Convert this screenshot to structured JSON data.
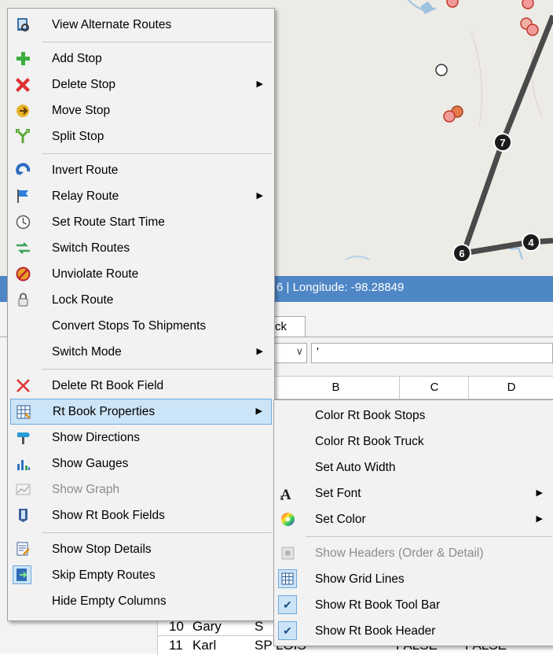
{
  "status_bar": {
    "text": "6 | Longitude: -98.28849"
  },
  "sheet_tab": {
    "label": "ck"
  },
  "formula_bar": {
    "value": "'"
  },
  "columns": [
    "B",
    "C",
    "D"
  ],
  "rows": [
    {
      "num": "10",
      "name": "Gary",
      "col_b": "S"
    },
    {
      "num": "11",
      "name": "Karl",
      "col_b": "SP LOIS",
      "col_c": "FALSE",
      "col_d": "FALSE"
    }
  ],
  "map": {
    "route_markers": [
      "7",
      "6",
      "4"
    ]
  },
  "context_menu": {
    "items": [
      {
        "label": "View Alternate Routes",
        "icon": "view-routes-icon"
      },
      {
        "label": "Add Stop",
        "icon": "green-plus-icon"
      },
      {
        "label": "Delete Stop",
        "icon": "red-x-icon",
        "submenu": true
      },
      {
        "label": "Move Stop",
        "icon": "move-stop-icon"
      },
      {
        "label": "Split Stop",
        "icon": "split-icon"
      },
      {
        "label": "Invert Route",
        "icon": "invert-icon"
      },
      {
        "label": "Relay Route",
        "icon": "flag-icon",
        "submenu": true
      },
      {
        "label": "Set Route Start Time",
        "icon": "clock-icon"
      },
      {
        "label": "Switch Routes",
        "icon": "switch-icon"
      },
      {
        "label": "Unviolate Route",
        "icon": "unviolate-icon"
      },
      {
        "label": "Lock Route",
        "icon": "lock-icon"
      },
      {
        "label": "Convert Stops To Shipments",
        "icon": ""
      },
      {
        "label": "Switch Mode",
        "icon": "",
        "submenu": true
      },
      {
        "label": "Delete Rt Book Field",
        "icon": "red-x-thin-icon"
      },
      {
        "label": "Rt Book Properties",
        "icon": "properties-icon",
        "submenu": true,
        "highlighted": true
      },
      {
        "label": "Show Directions",
        "icon": "signpost-icon"
      },
      {
        "label": "Show Gauges",
        "icon": "bar-chart-icon"
      },
      {
        "label": "Show Graph",
        "icon": "graph-icon",
        "disabled": true
      },
      {
        "label": "Show Rt Book Fields",
        "icon": "fields-icon"
      },
      {
        "label": "Show Stop Details",
        "icon": "details-icon"
      },
      {
        "label": "Skip Empty Routes",
        "icon": "skip-icon",
        "checked": true
      },
      {
        "label": "Hide Empty Columns",
        "icon": ""
      }
    ]
  },
  "submenu": {
    "items": [
      {
        "label": "Color Rt Book Stops",
        "icon": ""
      },
      {
        "label": "Color Rt Book Truck",
        "icon": ""
      },
      {
        "label": "Set Auto Width",
        "icon": ""
      },
      {
        "label": "Set Font",
        "icon": "font-icon",
        "submenu": true
      },
      {
        "label": "Set Color",
        "icon": "color-wheel-icon",
        "submenu": true
      },
      {
        "label": "Show Headers (Order & Detail)",
        "icon": "headers-icon",
        "disabled": true
      },
      {
        "label": "Show Grid Lines",
        "icon": "grid-icon",
        "checked": true
      },
      {
        "label": "Show Rt Book Tool Bar",
        "icon": "check-icon",
        "checked": true
      },
      {
        "label": "Show Rt Book Header",
        "icon": "check-icon",
        "checked": true
      }
    ]
  },
  "colors": {
    "highlight": "#cce4f7",
    "status_bar": "#4f86c6",
    "map_bg": "#edebe6",
    "route_line": "#4a4a4a"
  }
}
